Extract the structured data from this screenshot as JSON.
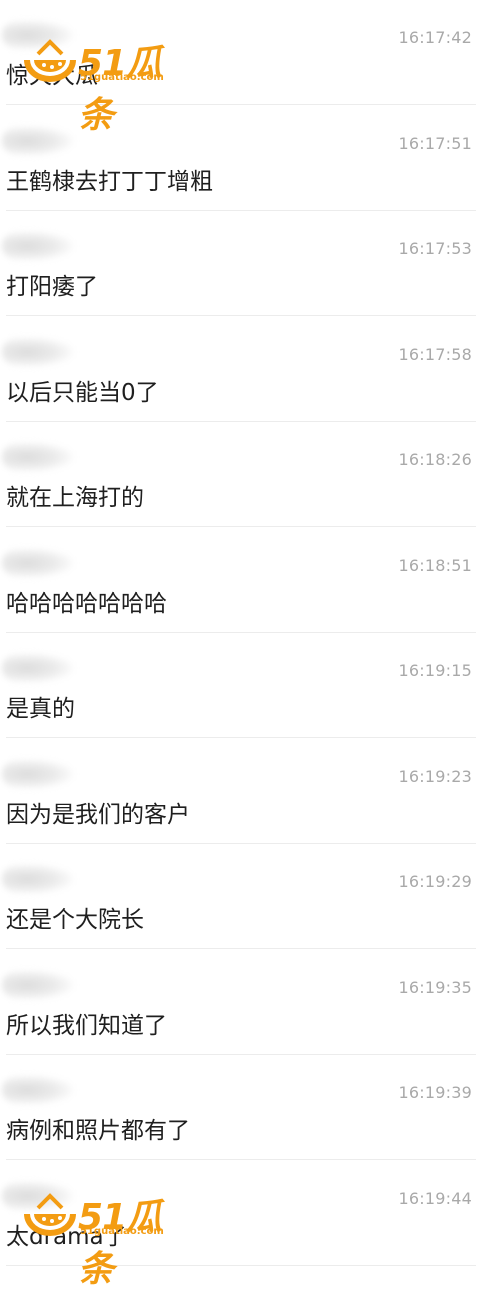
{
  "messages": [
    {
      "time": "16:17:42",
      "text": "惊天大瓜"
    },
    {
      "time": "16:17:51",
      "text": "王鹤棣去打丁丁增粗"
    },
    {
      "time": "16:17:53",
      "text": "打阳痿了"
    },
    {
      "time": "16:17:58",
      "text": "以后只能当0了"
    },
    {
      "time": "16:18:26",
      "text": "就在上海打的"
    },
    {
      "time": "16:18:51",
      "text": "哈哈哈哈哈哈哈"
    },
    {
      "time": "16:19:15",
      "text": "是真的"
    },
    {
      "time": "16:19:23",
      "text": "因为是我们的客户"
    },
    {
      "time": "16:19:29",
      "text": "还是个大院长"
    },
    {
      "time": "16:19:35",
      "text": "所以我们知道了"
    },
    {
      "time": "16:19:39",
      "text": "病例和照片都有了"
    },
    {
      "time": "16:19:44",
      "text": "太drama了"
    }
  ],
  "watermark": {
    "brand": "51瓜条",
    "url": "51guatiao.com",
    "color": "#f39c12",
    "icon": "watermelon-logo-icon"
  }
}
